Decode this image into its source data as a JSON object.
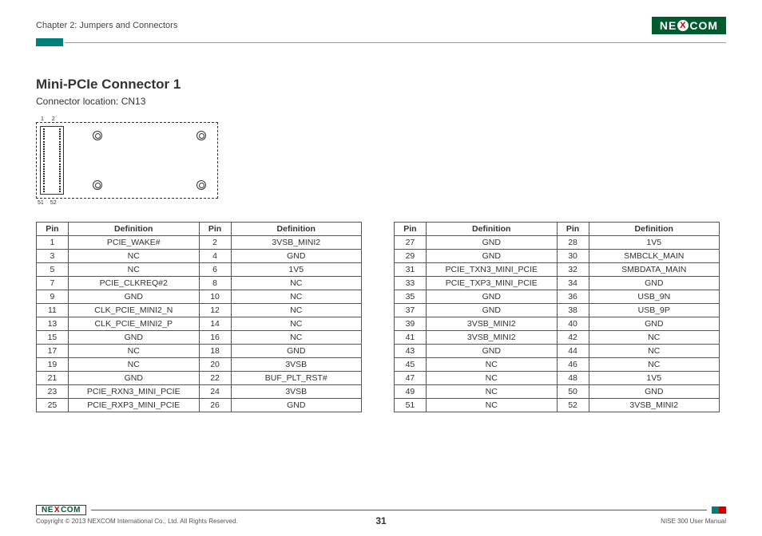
{
  "header": {
    "chapter": "Chapter 2: Jumpers and Connectors",
    "brand_pre": "NE",
    "brand_x": "X",
    "brand_post": "COM"
  },
  "section": {
    "title": "Mini-PCIe Connector 1",
    "sub": "Connector location: CN13"
  },
  "diagram": {
    "p1": "1",
    "p2": "2",
    "p51": "51",
    "p52": "52"
  },
  "tableHeaders": {
    "pin": "Pin",
    "def": "Definition"
  },
  "rowsA": [
    {
      "p1": "1",
      "d1": "PCIE_WAKE#",
      "p2": "2",
      "d2": "3VSB_MINI2"
    },
    {
      "p1": "3",
      "d1": "NC",
      "p2": "4",
      "d2": "GND"
    },
    {
      "p1": "5",
      "d1": "NC",
      "p2": "6",
      "d2": "1V5"
    },
    {
      "p1": "7",
      "d1": "PCIE_CLKREQ#2",
      "p2": "8",
      "d2": "NC"
    },
    {
      "p1": "9",
      "d1": "GND",
      "p2": "10",
      "d2": "NC"
    },
    {
      "p1": "11",
      "d1": "CLK_PCIE_MINI2_N",
      "p2": "12",
      "d2": "NC"
    },
    {
      "p1": "13",
      "d1": "CLK_PCIE_MINI2_P",
      "p2": "14",
      "d2": "NC"
    },
    {
      "p1": "15",
      "d1": "GND",
      "p2": "16",
      "d2": "NC"
    },
    {
      "p1": "17",
      "d1": "NC",
      "p2": "18",
      "d2": "GND"
    },
    {
      "p1": "19",
      "d1": "NC",
      "p2": "20",
      "d2": "3VSB"
    },
    {
      "p1": "21",
      "d1": "GND",
      "p2": "22",
      "d2": "BUF_PLT_RST#"
    },
    {
      "p1": "23",
      "d1": "PCIE_RXN3_MINI_PCIE",
      "p2": "24",
      "d2": "3VSB"
    },
    {
      "p1": "25",
      "d1": "PCIE_RXP3_MINI_PCIE",
      "p2": "26",
      "d2": "GND"
    }
  ],
  "rowsB": [
    {
      "p1": "27",
      "d1": "GND",
      "p2": "28",
      "d2": "1V5"
    },
    {
      "p1": "29",
      "d1": "GND",
      "p2": "30",
      "d2": "SMBCLK_MAIN"
    },
    {
      "p1": "31",
      "d1": "PCIE_TXN3_MINI_PCIE",
      "p2": "32",
      "d2": "SMBDATA_MAIN"
    },
    {
      "p1": "33",
      "d1": "PCIE_TXP3_MINI_PCIE",
      "p2": "34",
      "d2": "GND"
    },
    {
      "p1": "35",
      "d1": "GND",
      "p2": "36",
      "d2": "USB_9N"
    },
    {
      "p1": "37",
      "d1": "GND",
      "p2": "38",
      "d2": "USB_9P"
    },
    {
      "p1": "39",
      "d1": "3VSB_MINI2",
      "p2": "40",
      "d2": "GND"
    },
    {
      "p1": "41",
      "d1": "3VSB_MINI2",
      "p2": "42",
      "d2": "NC"
    },
    {
      "p1": "43",
      "d1": "GND",
      "p2": "44",
      "d2": "NC"
    },
    {
      "p1": "45",
      "d1": "NC",
      "p2": "46",
      "d2": "NC"
    },
    {
      "p1": "47",
      "d1": "NC",
      "p2": "48",
      "d2": "1V5"
    },
    {
      "p1": "49",
      "d1": "NC",
      "p2": "50",
      "d2": "GND"
    },
    {
      "p1": "51",
      "d1": "NC",
      "p2": "52",
      "d2": "3VSB_MINI2"
    }
  ],
  "footer": {
    "copyright": "Copyright © 2013 NEXCOM International Co., Ltd. All Rights Reserved.",
    "page": "31",
    "doc": "NISE 300 User Manual"
  }
}
